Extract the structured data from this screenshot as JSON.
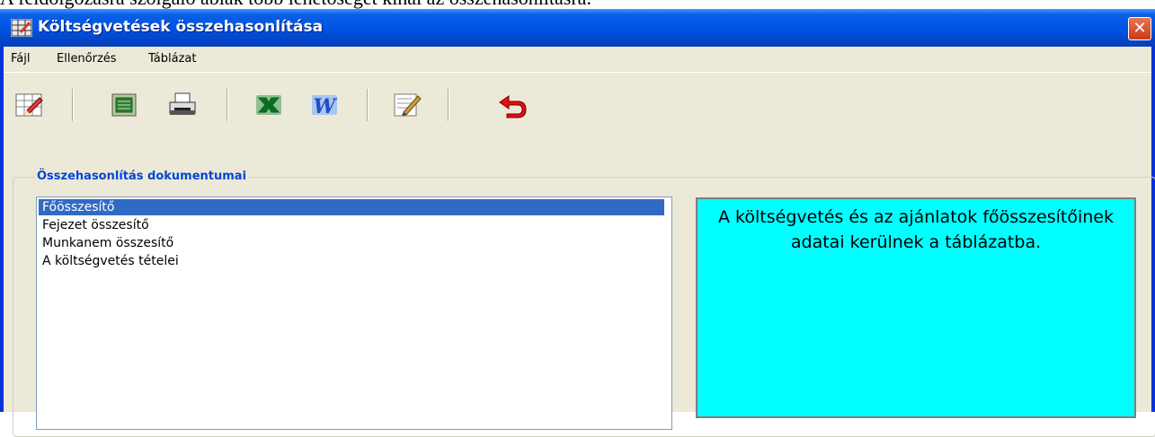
{
  "caption": "A feldolgozásra szolgáló ablak több lehetőséget kínál az összehasonlításra.",
  "window": {
    "title": "Költségvetések összehasonlítása",
    "close_glyph": "✕"
  },
  "menu": [
    {
      "label": "Fájl"
    },
    {
      "label": "Ellenőrzés"
    },
    {
      "label": "Táblázat"
    }
  ],
  "toolbar": [
    {
      "icon": "table-edit-icon"
    },
    {
      "icon": "document-view-icon"
    },
    {
      "icon": "printer-icon"
    },
    {
      "icon": "excel-icon"
    },
    {
      "icon": "word-icon"
    },
    {
      "icon": "edit-pencil-icon"
    },
    {
      "icon": "back-arrow-icon"
    }
  ],
  "group": {
    "label": "Összehasonlítás dokumentumai"
  },
  "list": {
    "selected_index": 0,
    "items": [
      "Főösszesítő",
      "Fejezet összesítő",
      "Munkanem összesítő",
      "A költségvetés tételei"
    ]
  },
  "info": {
    "text": "A költségvetés és az ajánlatok főösszesítőinek adatai kerülnek a táblázatba."
  },
  "colors": {
    "titlebar": "#0055e5",
    "window_bg": "#ece9d8",
    "selection": "#316ac5",
    "info_bg": "#00ffff",
    "group_label": "#0046d5"
  }
}
